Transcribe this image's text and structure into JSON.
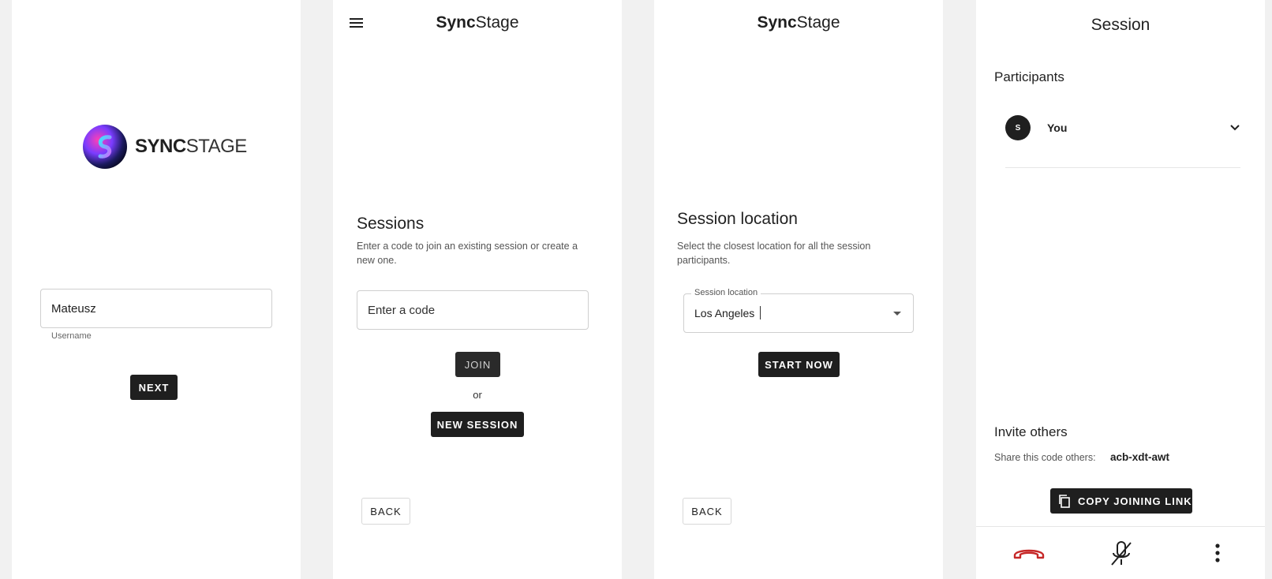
{
  "login": {
    "logo_text_bold": "SYNC",
    "logo_text_light": "STAGE",
    "username_value": "Mateusz",
    "username_label": "Username",
    "next_label": "NEXT"
  },
  "sessions": {
    "app_title_bold": "Sync",
    "app_title_light": "Stage",
    "menu_icon": "hamburger-menu-icon",
    "title": "Sessions",
    "subtitle": "Enter a code to join an existing session or create a new one.",
    "code_placeholder": "Enter a code",
    "join_label": "JOIN",
    "or_label": "or",
    "new_session_label": "NEW SESSION",
    "back_label": "BACK"
  },
  "location": {
    "app_title_bold": "Sync",
    "app_title_light": "Stage",
    "title": "Session location",
    "subtitle": "Select the closest location for all the session participants.",
    "field_label": "Session location",
    "field_value": "Los Angeles",
    "start_label": "START NOW",
    "back_label": "BACK"
  },
  "session": {
    "title": "Session",
    "participants_heading": "Participants",
    "participants": [
      {
        "avatar_letter": "S",
        "name": "You"
      }
    ],
    "invite_heading": "Invite others",
    "share_label": "Share this code others:",
    "share_code": "acb-xdt-awt",
    "copy_label": "COPY JOINING LINK",
    "colors": {
      "hangup": "#c62828",
      "dark": "#1f1f1f"
    }
  }
}
